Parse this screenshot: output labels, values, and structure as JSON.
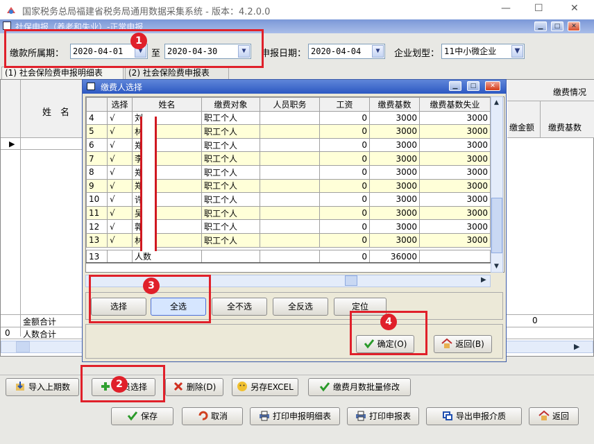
{
  "window": {
    "title": "国家税务总局福建省税务局通用数据采集系统 - 版本：4.2.0.0",
    "minimize": "—",
    "maximize": "☐",
    "close": "✕"
  },
  "subwindow": {
    "title": "社保申报（养老和失业）-正常申报"
  },
  "filters": {
    "period_label": "缴款所属期：",
    "period_start": "2020-04-01",
    "to_label": "至",
    "period_end": "2020-04-30",
    "declare_date_label": "申报日期：",
    "declare_date": "2020-04-04",
    "enterprise_type_label": "企业划型：",
    "enterprise_type": "11中小微企业"
  },
  "tabs": [
    "(1) 社会保险费申报明细表",
    "(2) 社会保险费申报表"
  ],
  "main_grid": {
    "name_header": "姓　名",
    "right_header": "缴费情况",
    "col_a": "缴金额",
    "col_b": "缴费基数",
    "total_amount_label": "金额合计",
    "total_amount_value": "0",
    "total_count_num": "0",
    "total_count_label": "人数合计"
  },
  "dialog": {
    "title": "缴费人选择",
    "columns": [
      "",
      "选择",
      "姓名",
      "缴费对象",
      "人员职务",
      "工资",
      "缴费基数",
      "缴费基数失业"
    ],
    "rows": [
      {
        "n": "4",
        "sel": "√",
        "name": "刘",
        "obj": "职工个人",
        "job": "",
        "wage": "0",
        "base": "3000",
        "base2": "3000"
      },
      {
        "n": "5",
        "sel": "√",
        "name": "林",
        "obj": "职工个人",
        "job": "",
        "wage": "0",
        "base": "3000",
        "base2": "3000"
      },
      {
        "n": "6",
        "sel": "√",
        "name": "郑",
        "obj": "职工个人",
        "job": "",
        "wage": "0",
        "base": "3000",
        "base2": "3000"
      },
      {
        "n": "7",
        "sel": "√",
        "name": "李",
        "obj": "职工个人",
        "job": "",
        "wage": "0",
        "base": "3000",
        "base2": "3000"
      },
      {
        "n": "8",
        "sel": "√",
        "name": "郑",
        "obj": "职工个人",
        "job": "",
        "wage": "0",
        "base": "3000",
        "base2": "3000"
      },
      {
        "n": "9",
        "sel": "√",
        "name": "郑",
        "obj": "职工个人",
        "job": "",
        "wage": "0",
        "base": "3000",
        "base2": "3000"
      },
      {
        "n": "10",
        "sel": "√",
        "name": "许",
        "obj": "职工个人",
        "job": "",
        "wage": "0",
        "base": "3000",
        "base2": "3000"
      },
      {
        "n": "11",
        "sel": "√",
        "name": "吴",
        "obj": "职工个人",
        "job": "",
        "wage": "0",
        "base": "3000",
        "base2": "3000"
      },
      {
        "n": "12",
        "sel": "√",
        "name": "郭",
        "obj": "职工个人",
        "job": "",
        "wage": "0",
        "base": "3000",
        "base2": "3000"
      },
      {
        "n": "13",
        "sel": "√",
        "name": "林",
        "obj": "职工个人",
        "job": "",
        "wage": "0",
        "base": "3000",
        "base2": "3000"
      }
    ],
    "summary": {
      "n": "13",
      "label": "人数",
      "wage": "0",
      "base": "36000"
    },
    "buttons": {
      "select": "选择",
      "select_all": "全选",
      "select_none": "全不选",
      "invert": "全反选",
      "locate": "定位",
      "ok": "确定(O)",
      "back": "返回(B)"
    }
  },
  "toolbar1": {
    "import": "导入上期数",
    "person_select": "人员选择",
    "delete": "删除(D)",
    "export_excel": "另存EXCEL",
    "batch_edit": "缴费月数批量修改"
  },
  "toolbar2": {
    "save": "保存",
    "cancel": "取消",
    "print_detail": "打印申报明细表",
    "print_form": "打印申报表",
    "export_media": "导出申报介质",
    "back": "返回"
  },
  "markers": [
    "1",
    "2",
    "3",
    "4"
  ],
  "colors": {
    "highlight": "#e0202a",
    "row_alt": "#ffffd8",
    "title_blue": "#2c58c2"
  }
}
